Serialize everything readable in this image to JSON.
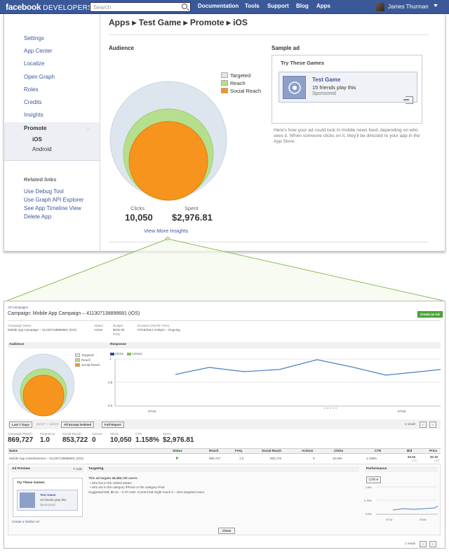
{
  "topbar": {
    "logo": "facebook",
    "logo_sub": "DEVELOPERS",
    "search_placeholder": "Search",
    "nav": [
      "Documentation",
      "Tools",
      "Support",
      "Blog",
      "Apps"
    ],
    "user": "James Thurman"
  },
  "leftnav": {
    "items": [
      "Settings",
      "App Center",
      "Localize",
      "Open Graph",
      "Roles",
      "Credits",
      "Insights"
    ],
    "active": "Promote",
    "subitems": [
      "iOS",
      "Android"
    ],
    "related_title": "Related links",
    "related": [
      "Use Debug Tool",
      "Use Graph API Explorer",
      "See App Timeline View",
      "Delete App"
    ]
  },
  "breadcrumb": "Apps ▸ Test Game ▸ Promote ▸ iOS",
  "audience": {
    "title": "Audience",
    "legend": [
      {
        "label": "Targeted",
        "color": "#dde6ef"
      },
      {
        "label": "Reach",
        "color": "#b5df8c"
      },
      {
        "label": "Social Reach",
        "color": "#f7941d"
      }
    ],
    "clicks_label": "Clicks",
    "clicks": "10,050",
    "spent_label": "Spent",
    "spent": "$2,976.81",
    "view_more": "View More Insights"
  },
  "sample_ad": {
    "title": "Sample ad",
    "try": "Try These Games",
    "game": "Test Game",
    "friends": "15 friends play this",
    "sponsored": "Sponsored",
    "description": "Here's how your ad could look in mobile news feed, depending on who sees it. When someone clicks on it, they'll be directed to your app in the App Store."
  },
  "campaign": {
    "all": "All Campaigns",
    "title": "Campaign: Mobile App Campaign – 411307138898681 (iOS)",
    "create": "Create an Ad",
    "name_label": "Campaign Name",
    "name": "Mobile App Campaign – 411307138898681 (iOS)",
    "status_label": "Status",
    "status": "Active",
    "budget_label": "Budget",
    "budget": "$100.00",
    "budget_sub": "Daily",
    "duration_label": "Duration (Pacific Time)",
    "duration": "07/16/2012 3:05pm – Ongoing",
    "audience_h": "Audience",
    "response_h": "Response",
    "clicks_legend": "Clicks",
    "actions_legend": "Actions",
    "yticks": [
      "1",
      "0.5",
      "0.0"
    ],
    "xticks": [
      "07/16",
      "07/20"
    ],
    "range": "Last 7 Days",
    "range_text": "Jul 17 — Jul 23",
    "filter": "All Except Deleted",
    "full_report": "Full Report",
    "results": "1 result",
    "stats": [
      {
        "label": "Campaign Reach",
        "value": "869,727"
      },
      {
        "label": "Frequency",
        "value": "1.0"
      },
      {
        "label": "Social Reach",
        "value": "853,722"
      },
      {
        "label": "Actions",
        "value": "0"
      },
      {
        "label": "Clicks",
        "value": "10,050"
      },
      {
        "label": "CTR",
        "value": "1.158%"
      },
      {
        "label": "Spent",
        "value": "$2,976.81"
      }
    ],
    "columns": [
      "Name",
      "Status",
      "Reach",
      "Freq.",
      "Social Reach",
      "Actions",
      "Clicks",
      "CTR",
      "Bid",
      "Price"
    ],
    "row": {
      "name": "Mobile App Advertisement – 411307138898681 (iOS)",
      "reach": "869,727",
      "freq": "1.0",
      "social": "853,722",
      "actions": "0",
      "clicks": "10,050",
      "ctr": "1.158%",
      "bid": "$0.50",
      "bid_sub": "CPC",
      "price": "$0.30",
      "price_sub": "CPC"
    },
    "ad_preview": "Ad Preview",
    "edit": "Edit",
    "targeting": "Targeting",
    "targeting_text": "This ad targets 48,486,740 users:",
    "t1": "who live in the United States",
    "t2": "who are in the category iPhone or the category iPad",
    "suggested": "Suggested Bid: $0.31 – 0.70 USD. Current bid might reach 0 – 25% targeted users.",
    "performance": "Performance",
    "ctr_sel": "CTR",
    "pyticks": [
      "1.5%",
      "0.75%",
      "0.0%"
    ],
    "pxticks": [
      "07/14",
      "07/20"
    ],
    "similar": "Create a Similar Ad",
    "close": "Close"
  }
}
